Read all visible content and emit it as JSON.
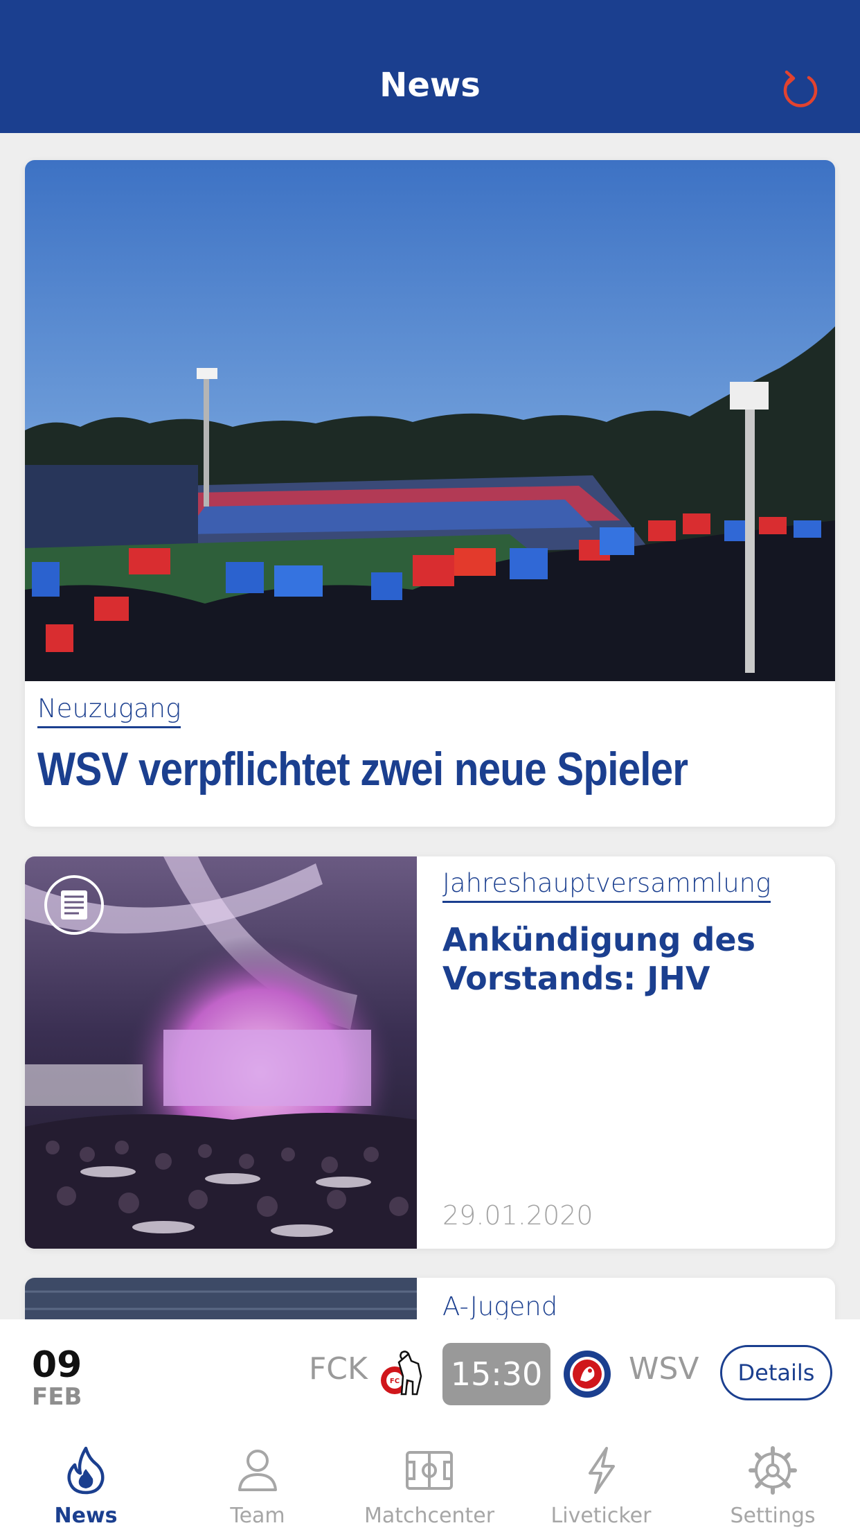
{
  "header": {
    "title": "News",
    "refresh_icon": "refresh-icon"
  },
  "articles": [
    {
      "category": "Neuzugang",
      "headline": "WSV verpflichtet zwei neue Spieler"
    },
    {
      "category": "Jahreshauptversammlung",
      "headline": "Ankündigung des Vorstands: JHV",
      "date": "29.01.2020",
      "type_icon": "document-icon"
    },
    {
      "category": "A-Jugend"
    }
  ],
  "match": {
    "day": "09",
    "month": "FEB",
    "home": "FCK",
    "time": "15:30",
    "away": "WSV",
    "details_label": "Details"
  },
  "tabs": [
    {
      "label": "News",
      "icon": "flame-icon",
      "active": true
    },
    {
      "label": "Team",
      "icon": "person-icon"
    },
    {
      "label": "Matchcenter",
      "icon": "pitch-icon"
    },
    {
      "label": "Liveticker",
      "icon": "lightning-icon"
    },
    {
      "label": "Settings",
      "icon": "gear-icon"
    }
  ],
  "colors": {
    "primary": "#1b3f8f",
    "accent": "#e2432f",
    "muted": "#a6a6a6",
    "time_box": "#999999"
  }
}
